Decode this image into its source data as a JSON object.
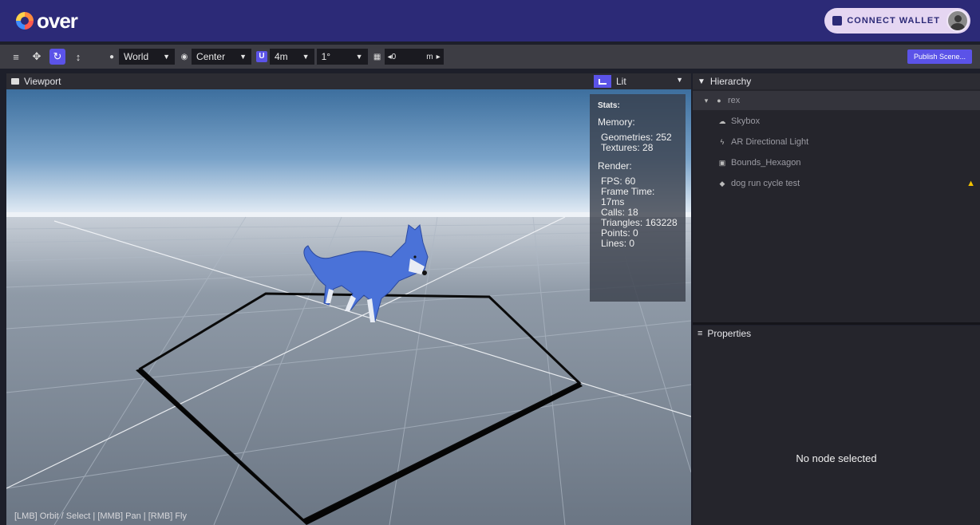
{
  "app": {
    "logo_text": "over"
  },
  "header": {
    "connect_wallet_label": "CONNECT WALLET"
  },
  "toolbar": {
    "space": "World",
    "pivot": "Center",
    "snap_distance": "4m",
    "snap_angle": "1°",
    "grid_value": "0",
    "grid_unit": "m",
    "publish_label": "Publish Scene..."
  },
  "viewport": {
    "title": "Viewport",
    "shading": "Lit",
    "help_text": "[LMB] Orbit / Select | [MMB] Pan | [RMB] Fly"
  },
  "stats": {
    "title": "Stats:",
    "memory_label": "Memory:",
    "geometries": "Geometries: 252",
    "textures": "Textures: 28",
    "render_label": "Render:",
    "fps": "FPS: 60",
    "frame_time": "Frame Time: 17ms",
    "calls": "Calls: 18",
    "triangles": "Triangles: 163228",
    "points": "Points: 0",
    "lines": "Lines: 0"
  },
  "hierarchy": {
    "title": "Hierarchy",
    "root": "rex",
    "items": [
      {
        "label": "Skybox",
        "icon": "cloud-icon"
      },
      {
        "label": "AR Directional Light",
        "icon": "light-icon"
      },
      {
        "label": "Bounds_Hexagon",
        "icon": "bounds-icon"
      },
      {
        "label": "dog run cycle test",
        "icon": "model-icon"
      }
    ]
  },
  "properties": {
    "title": "Properties",
    "empty_text": "No node selected"
  },
  "colors": {
    "topbar": "#2c2a77",
    "accent": "#5b53e8",
    "panel": "#25252c",
    "warning": "#f2c200"
  }
}
